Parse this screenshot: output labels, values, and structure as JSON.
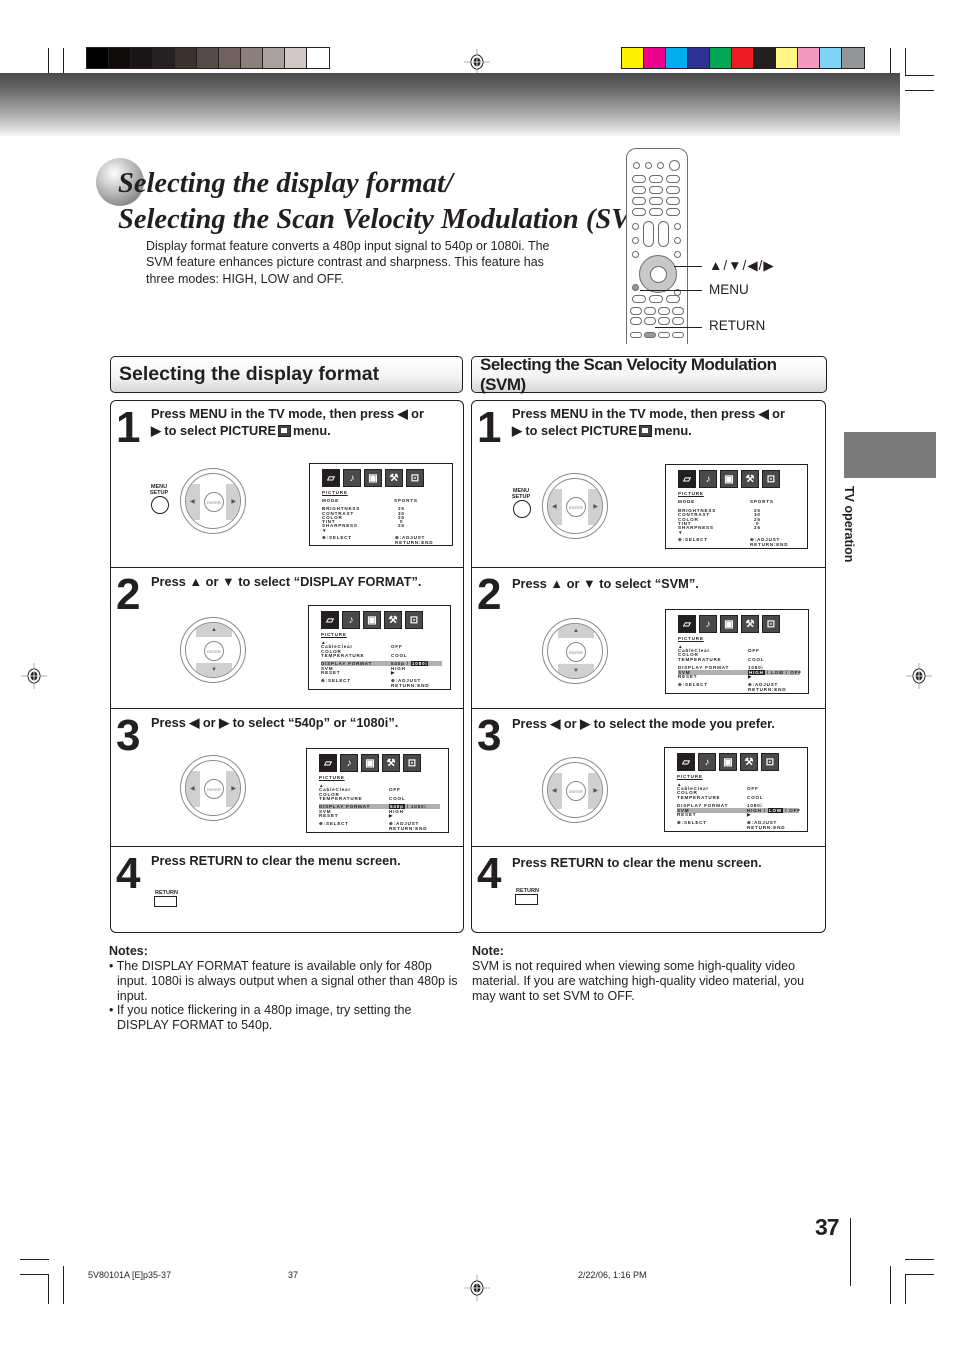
{
  "print_marks": {
    "grayscale_swatches": [
      "#000000",
      "#0e0b0a",
      "#1a1615",
      "#262120",
      "#3b3230",
      "#564b48",
      "#6e615e",
      "#8b7f7c",
      "#aaa09d",
      "#d2c8c7",
      "#ffffff"
    ],
    "color_swatches": [
      "#fff200",
      "#ec008c",
      "#00aeef",
      "#2e3192",
      "#00a651",
      "#ed1c24",
      "#231f20",
      "#fff685",
      "#f49ac1",
      "#7fd3f7",
      "#939598"
    ]
  },
  "title": {
    "line1": "Selecting the display format/",
    "line2": "Selecting the Scan Velocity Modulation (SVM)"
  },
  "intro": "Display format feature converts a 480p input signal to 540p or 1080i. The SVM feature enhances picture contrast and sharpness. This feature has three modes: HIGH, LOW and OFF.",
  "remote_callouts": {
    "arrows": "▲/▼/◀/▶",
    "menu": "MENU",
    "return": "RETURN"
  },
  "side_tab": {
    "label": "TV operation"
  },
  "buttons": {
    "menu_setup": "MENU\nSETUP",
    "enter": "ENTER",
    "return": "RETURN"
  },
  "osd_common": {
    "icons": [
      "picture-icon",
      "audio-icon",
      "setup-icon",
      "wrench-icon",
      "lock-icon"
    ],
    "title": "PICTURE",
    "select": ":SELECT",
    "adjust": ":ADJUST",
    "return_end": "RETURN:END"
  },
  "osd_picture_menu": {
    "mode_label": "MODE",
    "mode_value": "SPORTS",
    "rows": [
      {
        "label": "BRIGHTNESS",
        "value": "25"
      },
      {
        "label": "CONTRAST",
        "value": "30"
      },
      {
        "label": "COLOR",
        "value": "25"
      },
      {
        "label": "TINT",
        "value": "0"
      },
      {
        "label": "SHARPNESS",
        "value": "25"
      }
    ]
  },
  "osd_page2": {
    "cableclear_label": "CableClear",
    "cableclear_value": "OFF",
    "color_label": "COLOR",
    "temperature_label": "TEMPERATURE",
    "temperature_value": "COOL",
    "display_format_label": "DISPLAY FORMAT",
    "svm_label": "SVM",
    "reset_label": "RESET"
  },
  "left_section": {
    "header": "Selecting the display format",
    "steps": [
      {
        "num": "1",
        "line1": "Press MENU in the TV mode, then press ◀ or",
        "line2a": "▶ to select PICTURE",
        "line2b": "menu."
      },
      {
        "num": "2",
        "text": "Press ▲ or ▼ to select “DISPLAY FORMAT”.",
        "osd": {
          "df_value_pre": "540p / ",
          "df_value_sel": "1080i",
          "df_value_post": "",
          "svm_value": "HIGH"
        }
      },
      {
        "num": "3",
        "text": "Press ◀ or ▶ to select “540p” or “1080i”.",
        "osd": {
          "df_value_pre": "",
          "df_value_sel": "540p",
          "df_value_post": " / 1080i",
          "svm_value": "HIGH"
        }
      },
      {
        "num": "4",
        "text": "Press RETURN to clear the menu screen."
      }
    ],
    "notes_title": "Notes:",
    "notes": [
      "• The DISPLAY FORMAT feature is available only for 480p input. 1080i is always output when a signal other than 480p is input.",
      "• If you notice flickering in a 480p image, try setting the DISPLAY FORMAT to 540p."
    ]
  },
  "right_section": {
    "header": "Selecting the Scan Velocity Modulation (SVM)",
    "steps": [
      {
        "num": "1",
        "line1": "Press MENU in the TV mode, then press ◀ or",
        "line2a": "▶ to select PICTURE",
        "line2b": "menu."
      },
      {
        "num": "2",
        "text": "Press ▲ or ▼ to select “SVM”.",
        "osd": {
          "df_value": "1080i",
          "svm_pre": "",
          "svm_sel": "HIGH",
          "svm_post": " / LOW / OFF"
        }
      },
      {
        "num": "3",
        "text": "Press ◀ or ▶ to select the mode you prefer.",
        "osd": {
          "df_value": "1080i",
          "svm_pre": "HIGH / ",
          "svm_sel": "LOW",
          "svm_post": " / OFF"
        }
      },
      {
        "num": "4",
        "text": "Press RETURN to clear the menu screen."
      }
    ],
    "note_title": "Note:",
    "note": "SVM is not required when viewing some high-quality video material. If you are watching high-quality video material, you may want to set SVM to OFF."
  },
  "page_number": "37",
  "footer": {
    "file": "5V80101A [E]p35-37",
    "page": "37",
    "date": "2/22/06, 1:16 PM"
  }
}
